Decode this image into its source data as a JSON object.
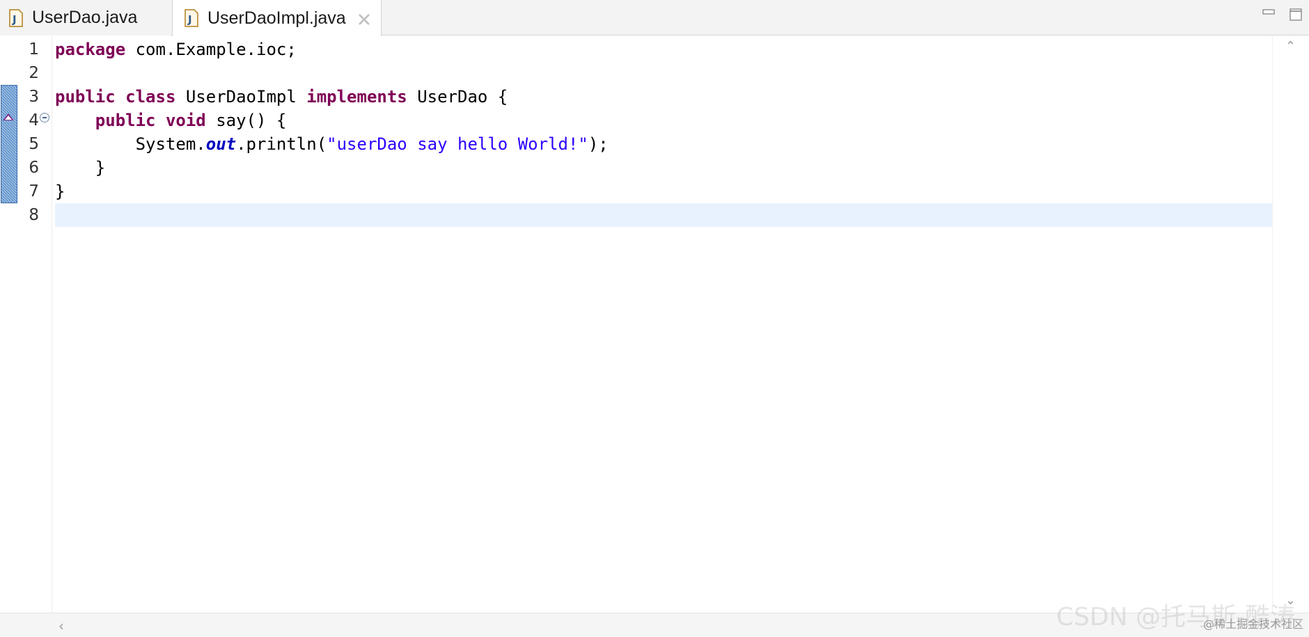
{
  "tabs": [
    {
      "label": "UserDao.java",
      "icon": "java-file-icon",
      "active": false
    },
    {
      "label": "UserDaoImpl.java",
      "icon": "java-file-icon",
      "active": true
    }
  ],
  "colors": {
    "keyword": "#7f0055",
    "string": "#2a00ff",
    "field": "#0000c0",
    "current_line": "#e8f2fe",
    "ruler_marker": "#5a8fcb"
  },
  "code": {
    "line_numbers": [
      "1",
      "2",
      "3",
      "4",
      "5",
      "6",
      "7",
      "8"
    ],
    "current_line": 8,
    "lines": [
      [
        {
          "t": "package",
          "k": "kw"
        },
        {
          "t": " com.Example.ioc;",
          "k": "plain"
        }
      ],
      [],
      [
        {
          "t": "public",
          "k": "kw"
        },
        {
          "t": " ",
          "k": "plain"
        },
        {
          "t": "class",
          "k": "kw"
        },
        {
          "t": " UserDaoImpl ",
          "k": "plain"
        },
        {
          "t": "implements",
          "k": "kw"
        },
        {
          "t": " UserDao {",
          "k": "plain"
        }
      ],
      [
        {
          "t": "    ",
          "k": "plain"
        },
        {
          "t": "public",
          "k": "kw"
        },
        {
          "t": " ",
          "k": "plain"
        },
        {
          "t": "void",
          "k": "kw"
        },
        {
          "t": " say() {",
          "k": "plain"
        }
      ],
      [
        {
          "t": "        System.",
          "k": "plain"
        },
        {
          "t": "out",
          "k": "fld"
        },
        {
          "t": ".println(",
          "k": "plain"
        },
        {
          "t": "\"userDao say hello World!\"",
          "k": "str"
        },
        {
          "t": ");",
          "k": "plain"
        }
      ],
      [
        {
          "t": "    }",
          "k": "plain"
        }
      ],
      [
        {
          "t": "}",
          "k": "plain"
        }
      ],
      []
    ]
  },
  "watermark": "CSDN @托马斯-酷涛",
  "watermark2": "@稀土掘金技术社区"
}
